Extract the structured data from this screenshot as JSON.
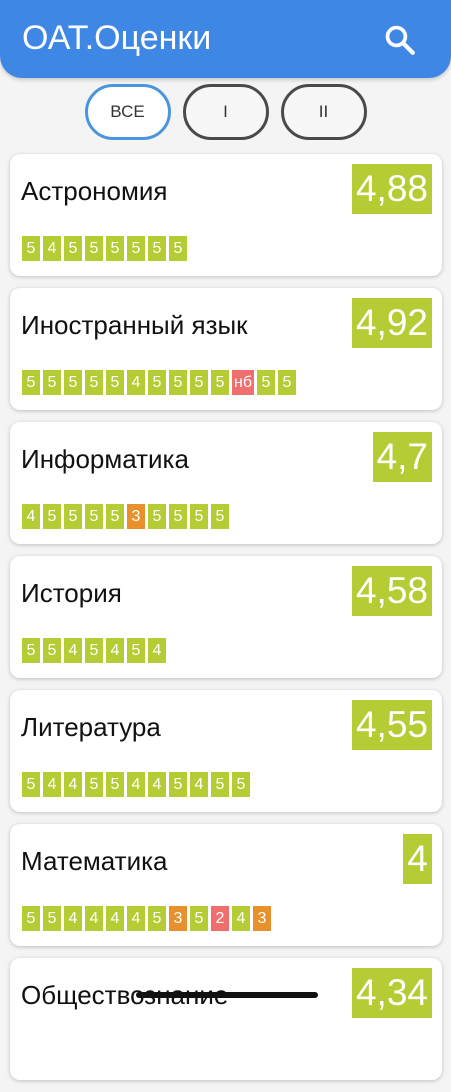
{
  "colors": {
    "appbar": "#3f87e5",
    "good": "#b5cc35",
    "ok": "#e8902c",
    "bad": "#ef6f6f"
  },
  "appbar": {
    "title": "ОАТ.Оценки",
    "search_icon": "search-icon"
  },
  "filters": [
    {
      "label": "ВСЕ",
      "active": true
    },
    {
      "label": "I",
      "active": false
    },
    {
      "label": "II",
      "active": false
    }
  ],
  "subjects": [
    {
      "name": "Астрономия",
      "average": "4,88",
      "avg_color": "good",
      "grades": [
        [
          "5",
          "good"
        ],
        [
          "4",
          "good"
        ],
        [
          "5",
          "good"
        ],
        [
          "5",
          "good"
        ],
        [
          "5",
          "good"
        ],
        [
          "5",
          "good"
        ],
        [
          "5",
          "good"
        ],
        [
          "5",
          "good"
        ]
      ]
    },
    {
      "name": "Иностранный язык",
      "average": "4,92",
      "avg_color": "good",
      "grades": [
        [
          "5",
          "good"
        ],
        [
          "5",
          "good"
        ],
        [
          "5",
          "good"
        ],
        [
          "5",
          "good"
        ],
        [
          "5",
          "good"
        ],
        [
          "4",
          "good"
        ],
        [
          "5",
          "good"
        ],
        [
          "5",
          "good"
        ],
        [
          "5",
          "good"
        ],
        [
          "5",
          "good"
        ],
        [
          "нб",
          "bad"
        ],
        [
          "5",
          "good"
        ],
        [
          "5",
          "good"
        ]
      ]
    },
    {
      "name": "Информатика",
      "average": "4,7",
      "avg_color": "good",
      "grades": [
        [
          "4",
          "good"
        ],
        [
          "5",
          "good"
        ],
        [
          "5",
          "good"
        ],
        [
          "5",
          "good"
        ],
        [
          "5",
          "good"
        ],
        [
          "3",
          "ok"
        ],
        [
          "5",
          "good"
        ],
        [
          "5",
          "good"
        ],
        [
          "5",
          "good"
        ],
        [
          "5",
          "good"
        ]
      ]
    },
    {
      "name": "История",
      "average": "4,58",
      "avg_color": "good",
      "grades": [
        [
          "5",
          "good"
        ],
        [
          "5",
          "good"
        ],
        [
          "4",
          "good"
        ],
        [
          "5",
          "good"
        ],
        [
          "4",
          "good"
        ],
        [
          "5",
          "good"
        ],
        [
          "4",
          "good"
        ]
      ]
    },
    {
      "name": "Литература",
      "average": "4,55",
      "avg_color": "good",
      "grades": [
        [
          "5",
          "good"
        ],
        [
          "4",
          "good"
        ],
        [
          "4",
          "good"
        ],
        [
          "5",
          "good"
        ],
        [
          "5",
          "good"
        ],
        [
          "4",
          "good"
        ],
        [
          "4",
          "good"
        ],
        [
          "5",
          "good"
        ],
        [
          "4",
          "good"
        ],
        [
          "5",
          "good"
        ],
        [
          "5",
          "good"
        ]
      ]
    },
    {
      "name": "Математика",
      "average": "4",
      "avg_color": "good",
      "grades": [
        [
          "5",
          "good"
        ],
        [
          "5",
          "good"
        ],
        [
          "4",
          "good"
        ],
        [
          "4",
          "good"
        ],
        [
          "4",
          "good"
        ],
        [
          "4",
          "good"
        ],
        [
          "5",
          "good"
        ],
        [
          "3",
          "ok"
        ],
        [
          "5",
          "good"
        ],
        [
          "2",
          "bad"
        ],
        [
          "4",
          "good"
        ],
        [
          "3",
          "ok"
        ]
      ]
    },
    {
      "name": "Обществознание",
      "average": "4,34",
      "avg_color": "good",
      "grades": []
    }
  ]
}
